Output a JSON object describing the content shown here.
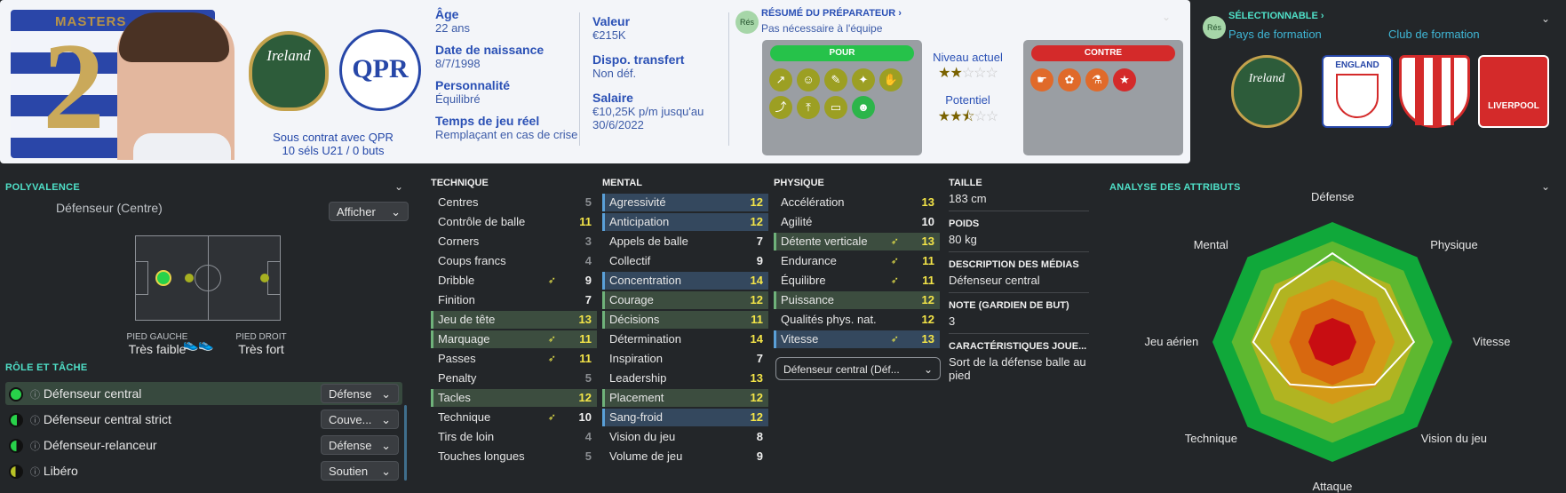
{
  "header": {
    "kit_name": "MASTERS",
    "kit_number": "2",
    "nation_badge": "Ireland",
    "club_badge": "QPR",
    "contract_line1": "Sous contrat avec QPR",
    "contract_line2": "10 séls U21 / 0 buts",
    "info": [
      {
        "label": "Âge",
        "value": "22 ans"
      },
      {
        "label": "Date de naissance",
        "value": "8/7/1998"
      },
      {
        "label": "Personnalité",
        "value": "Équilibré"
      },
      {
        "label": "Temps de jeu réel",
        "value": "Remplaçant en cas de crise"
      }
    ],
    "info2": [
      {
        "label": "Valeur",
        "value": "€215K"
      },
      {
        "label": "Dispo. transfert",
        "value": "Non déf."
      },
      {
        "label": "Salaire",
        "value": "€10,25K p/m jusqu'au",
        "value2": "30/6/2022"
      }
    ],
    "prep": {
      "res": "Rés",
      "title": "RÉSUMÉ DU PRÉPARATEUR ›",
      "subtitle": "Pas nécessaire à l'équipe",
      "pour": "POUR",
      "contre": "CONTRE",
      "niveau_actuel": "Niveau actuel",
      "potentiel": "Potentiel",
      "niveau_stars": 2,
      "potentiel_stars": 2.5
    }
  },
  "selection": {
    "res": "Rés",
    "title": "SÉLECTIONNABLE ›",
    "pays": "Pays de formation",
    "club": "Club de formation",
    "badges": [
      "Ireland",
      "ENGLAND",
      "Club",
      "LIVERPOOL"
    ]
  },
  "polyvalence": {
    "title": "POLYVALENCE",
    "position": "Défenseur (Centre)",
    "afficher": "Afficher",
    "pied_gauche_label": "PIED GAUCHE",
    "pied_gauche": "Très faible",
    "pied_droit_label": "PIED DROIT",
    "pied_droit": "Très fort"
  },
  "roles": {
    "title": "RÔLE ET TÂCHE",
    "items": [
      {
        "name": "Défenseur central",
        "duty": "Défense"
      },
      {
        "name": "Défenseur central strict",
        "duty": "Couve..."
      },
      {
        "name": "Défenseur-relanceur",
        "duty": "Défense"
      },
      {
        "name": "Libéro",
        "duty": "Soutien"
      }
    ]
  },
  "technique": {
    "title": "TECHNIQUE",
    "rows": [
      {
        "name": "Centres",
        "v": "5"
      },
      {
        "name": "Contrôle de balle",
        "v": "11"
      },
      {
        "name": "Corners",
        "v": "3"
      },
      {
        "name": "Coups francs",
        "v": "4"
      },
      {
        "name": "Dribble",
        "v": "9"
      },
      {
        "name": "Finition",
        "v": "7"
      },
      {
        "name": "Jeu de tête",
        "v": "13"
      },
      {
        "name": "Marquage",
        "v": "11"
      },
      {
        "name": "Passes",
        "v": "11"
      },
      {
        "name": "Penalty",
        "v": "5"
      },
      {
        "name": "Tacles",
        "v": "12"
      },
      {
        "name": "Technique",
        "v": "10"
      },
      {
        "name": "Tirs de loin",
        "v": "4"
      },
      {
        "name": "Touches longues",
        "v": "5"
      }
    ]
  },
  "mental": {
    "title": "MENTAL",
    "rows": [
      {
        "name": "Agressivité",
        "v": "12"
      },
      {
        "name": "Anticipation",
        "v": "12"
      },
      {
        "name": "Appels de balle",
        "v": "7"
      },
      {
        "name": "Collectif",
        "v": "9"
      },
      {
        "name": "Concentration",
        "v": "14"
      },
      {
        "name": "Courage",
        "v": "12"
      },
      {
        "name": "Décisions",
        "v": "11"
      },
      {
        "name": "Détermination",
        "v": "14"
      },
      {
        "name": "Inspiration",
        "v": "7"
      },
      {
        "name": "Leadership",
        "v": "13"
      },
      {
        "name": "Placement",
        "v": "12"
      },
      {
        "name": "Sang-froid",
        "v": "12"
      },
      {
        "name": "Vision du jeu",
        "v": "8"
      },
      {
        "name": "Volume de jeu",
        "v": "9"
      }
    ]
  },
  "physique": {
    "title": "PHYSIQUE",
    "rows": [
      {
        "name": "Accélération",
        "v": "13"
      },
      {
        "name": "Agilité",
        "v": "10"
      },
      {
        "name": "Détente verticale",
        "v": "13"
      },
      {
        "name": "Endurance",
        "v": "11"
      },
      {
        "name": "Équilibre",
        "v": "11"
      },
      {
        "name": "Puissance",
        "v": "12"
      },
      {
        "name": "Qualités phys. nat.",
        "v": "12"
      },
      {
        "name": "Vitesse",
        "v": "13"
      }
    ],
    "role_select": "Défenseur central (Déf..."
  },
  "details": {
    "taille_label": "TAILLE",
    "taille": "183 cm",
    "poids_label": "POIDS",
    "poids": "80 kg",
    "media_label": "DESCRIPTION DES MÉDIAS",
    "media": "Défenseur central",
    "gk_label": "NOTE (GARDIEN DE BUT)",
    "gk": "3",
    "traits_label": "CARACTÉRISTIQUES JOUE...",
    "traits": "Sort de la défense balle au pied"
  },
  "analyse": {
    "title": "ANALYSE DES ATTRIBUTS",
    "axes": [
      "Défense",
      "Physique",
      "Vitesse",
      "Vision du jeu",
      "Attaque",
      "Technique",
      "Jeu aérien",
      "Mental"
    ],
    "values": [
      0.74,
      0.62,
      0.68,
      0.5,
      0.38,
      0.5,
      0.66,
      0.62
    ]
  }
}
